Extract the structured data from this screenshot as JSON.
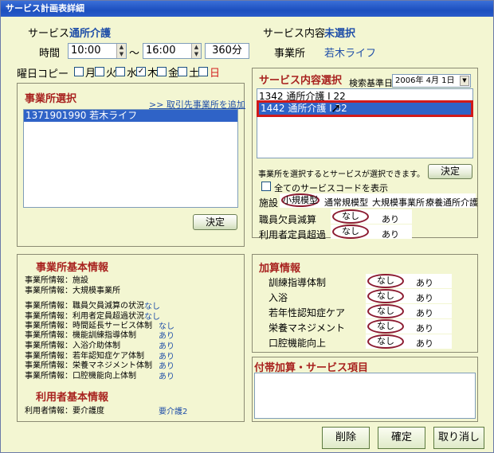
{
  "window": {
    "title": "サービス計画表詳細"
  },
  "header": {
    "service_label": "サービス",
    "service_value": "通所介護",
    "time_label": "時間",
    "time_from": "10:00",
    "time_sep": "〜",
    "time_to": "16:00",
    "duration": "360分",
    "service_content_label": "サービス内容",
    "service_content_value": "未選択",
    "office_label": "事業所",
    "office_value": "若木ライフ"
  },
  "weekday_copy": {
    "label": "曜日コピー",
    "days": [
      {
        "label": "月",
        "checked": false,
        "color": "#000000"
      },
      {
        "label": "火",
        "checked": false,
        "color": "#000000"
      },
      {
        "label": "水",
        "checked": false,
        "color": "#000000"
      },
      {
        "label": "木",
        "checked": true,
        "color": "#000000"
      },
      {
        "label": "金",
        "checked": false,
        "color": "#000000"
      },
      {
        "label": "土",
        "checked": false,
        "color": "#000000"
      },
      {
        "label": "日",
        "checked": false,
        "color": "#d22020"
      }
    ]
  },
  "office_select": {
    "title": "事業所選択",
    "add_link": ">> 取引先事業所を追加",
    "items": [
      "1371901990 若木ライフ"
    ],
    "confirm_label": "決定"
  },
  "service_select": {
    "title": "サービス内容選択",
    "search_label": "検索基準日",
    "search_date": "2006年 4月 1日",
    "items": [
      "1342 通所介護 I 22",
      "1442 通所介護 I 32"
    ],
    "hint": "事業所を選択するとサービスが選択できます。",
    "confirm_label": "決定",
    "show_all_label": "全てのサービスコードを表示",
    "facility_label": "施設",
    "facility_options": [
      "小規模型",
      "通常規模型",
      "大規模事業所",
      "療養通所介護"
    ],
    "staff_shortage_label": "職員欠員減算",
    "user_over_label": "利用者定員超過",
    "none_label": "なし",
    "yes_label": "あり"
  },
  "office_info": {
    "title": "事業所基本情報",
    "rows": [
      {
        "label": "事業所情報：施設",
        "value": ""
      },
      {
        "label": "事業所情報：大規模事業所",
        "value": ""
      },
      {
        "label": "事業所情報：職員欠員減算の状況",
        "value": "なし"
      },
      {
        "label": "事業所情報：利用者定員超過状況",
        "value": "なし"
      },
      {
        "label": "事業所情報：時間延長サービス体制",
        "value": "なし"
      },
      {
        "label": "事業所情報：機能訓練指導体制",
        "value": "あり"
      },
      {
        "label": "事業所情報：入浴介助体制",
        "value": "あり"
      },
      {
        "label": "事業所情報：若年認知症ケア体制",
        "value": "あり"
      },
      {
        "label": "事業所情報：栄養マネジメント体制",
        "value": "あり"
      },
      {
        "label": "事業所情報：口腔機能向上体制",
        "value": "あり"
      }
    ]
  },
  "user_info": {
    "title": "利用者基本情報",
    "label": "利用者情報：要介護度",
    "value": "要介護2"
  },
  "addition": {
    "title": "加算情報",
    "rows": [
      "訓練指導体制",
      "入浴",
      "若年性認知症ケア",
      "栄養マネジメント",
      "口腔機能向上"
    ],
    "none_label": "なし",
    "yes_label": "あり"
  },
  "extra": {
    "title": "付帯加算・サービス項目"
  },
  "footer": {
    "delete_label": "削除",
    "ok_label": "確定",
    "cancel_label": "取り消し"
  }
}
